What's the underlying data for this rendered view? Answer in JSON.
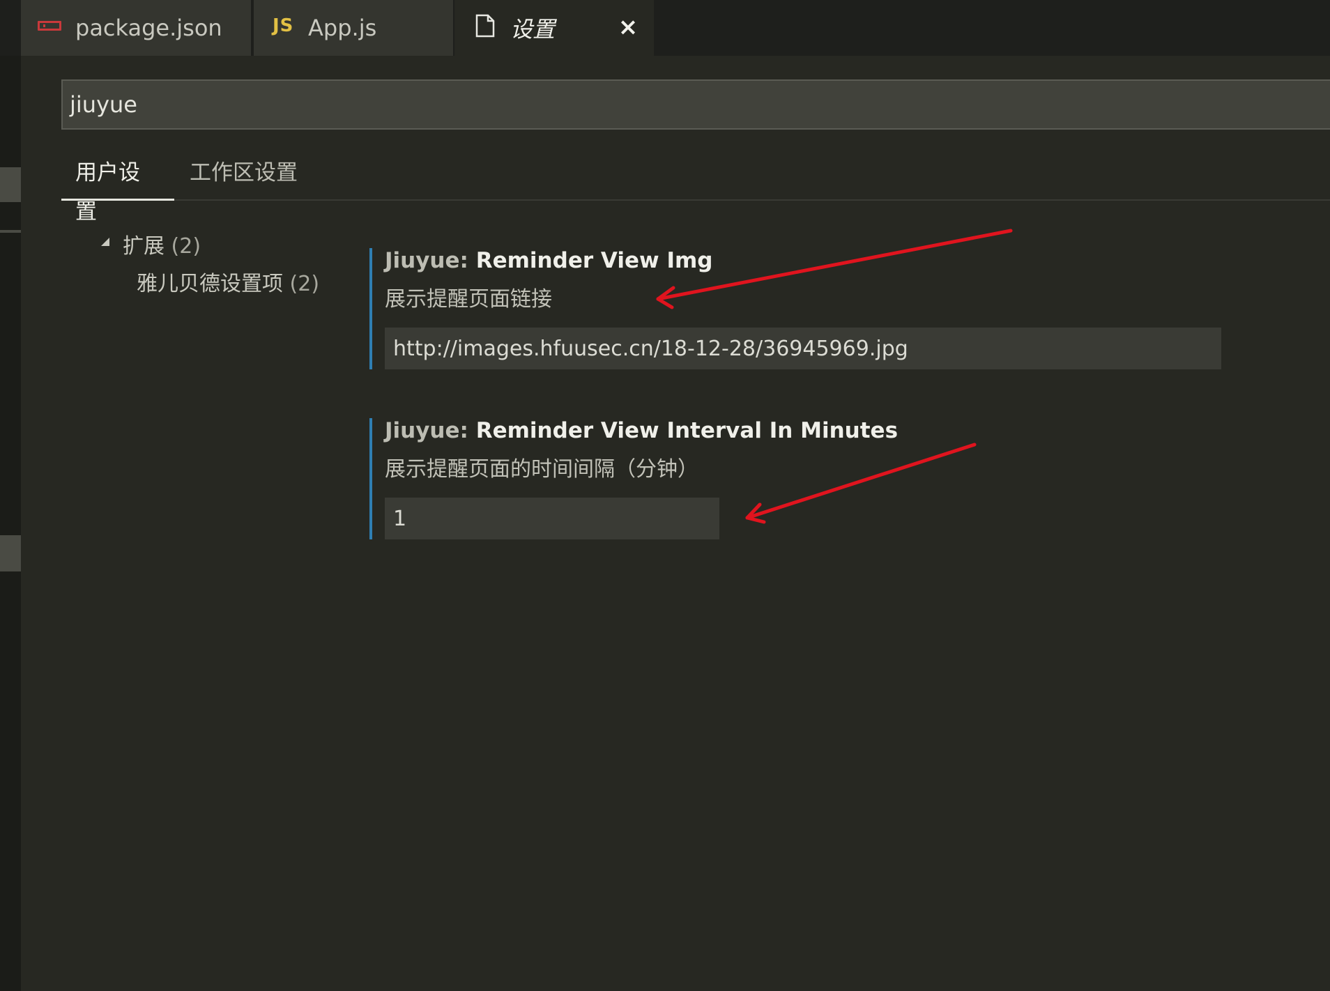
{
  "tabs": [
    {
      "label": "package.json",
      "icon": "npm-icon"
    },
    {
      "label": "App.js",
      "icon": "js-icon",
      "icon_text": "JS"
    },
    {
      "label": "设置",
      "icon": "file-icon",
      "active": true,
      "close_glyph": "×"
    }
  ],
  "search": {
    "value": "jiuyue"
  },
  "scope_tabs": {
    "user": "用户设置",
    "workspace": "工作区设置"
  },
  "tree": {
    "group_label": "扩展",
    "group_count": "(2)",
    "child_label": "雅儿贝德设置项",
    "child_count": "(2)"
  },
  "settings": [
    {
      "prefix": "Jiuyue: ",
      "name": "Reminder View Img",
      "description": "展示提醒页面链接",
      "value": "http://images.hfuusec.cn/18-12-28/36945969.jpg"
    },
    {
      "prefix": "Jiuyue: ",
      "name": "Reminder View Interval In Minutes",
      "description": "展示提醒页面的时间间隔（分钟）",
      "value": "1"
    }
  ],
  "colors": {
    "background": "#272822",
    "accent_border": "#2f7fb3",
    "annotation_arrow": "#e0141e",
    "npm_red": "#c9393b",
    "js_yellow": "#e2c044"
  }
}
